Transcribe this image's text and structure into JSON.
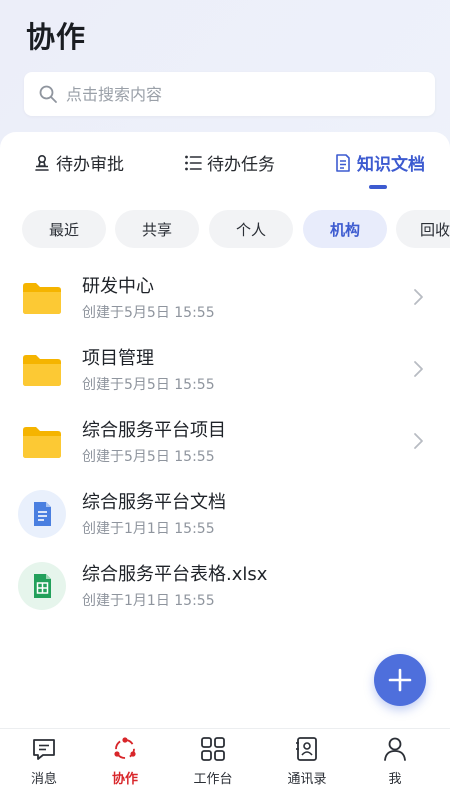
{
  "header": {
    "title": "协作"
  },
  "search": {
    "placeholder": "点击搜索内容"
  },
  "tabs": [
    {
      "label": "待办审批",
      "icon": "stamp-icon",
      "active": false
    },
    {
      "label": "待办任务",
      "icon": "checklist-icon",
      "active": false
    },
    {
      "label": "知识文档",
      "icon": "document-icon",
      "active": true
    }
  ],
  "filters": [
    {
      "label": "最近",
      "active": false
    },
    {
      "label": "共享",
      "active": false
    },
    {
      "label": "个人",
      "active": false
    },
    {
      "label": "机构",
      "active": true
    },
    {
      "label": "回收",
      "active": false
    }
  ],
  "files": [
    {
      "name": "研发中心",
      "meta": "创建于5月5日 15:55",
      "type": "folder"
    },
    {
      "name": "项目管理",
      "meta": "创建于5月5日 15:55",
      "type": "folder"
    },
    {
      "name": "综合服务平台项目",
      "meta": "创建于5月5日 15:55",
      "type": "folder"
    },
    {
      "name": "综合服务平台文档",
      "meta": "创建于1月1日 15:55",
      "type": "doc"
    },
    {
      "name": "综合服务平台表格.xlsx",
      "meta": "创建于1月1日 15:55",
      "type": "sheet"
    }
  ],
  "bottom_nav": [
    {
      "label": "消息",
      "icon": "message-icon",
      "active": false
    },
    {
      "label": "协作",
      "icon": "collaboration-icon",
      "active": true
    },
    {
      "label": "工作台",
      "icon": "grid-icon",
      "active": false
    },
    {
      "label": "通讯录",
      "icon": "contacts-icon",
      "active": false
    },
    {
      "label": "我",
      "icon": "user-icon",
      "active": false
    }
  ],
  "colors": {
    "accent": "#3d5bd0",
    "fab": "#4e6fdc",
    "active_nav": "#d8262a",
    "folder": "#fbc02d",
    "doc": "#4a7fe0",
    "sheet": "#22a05b"
  }
}
